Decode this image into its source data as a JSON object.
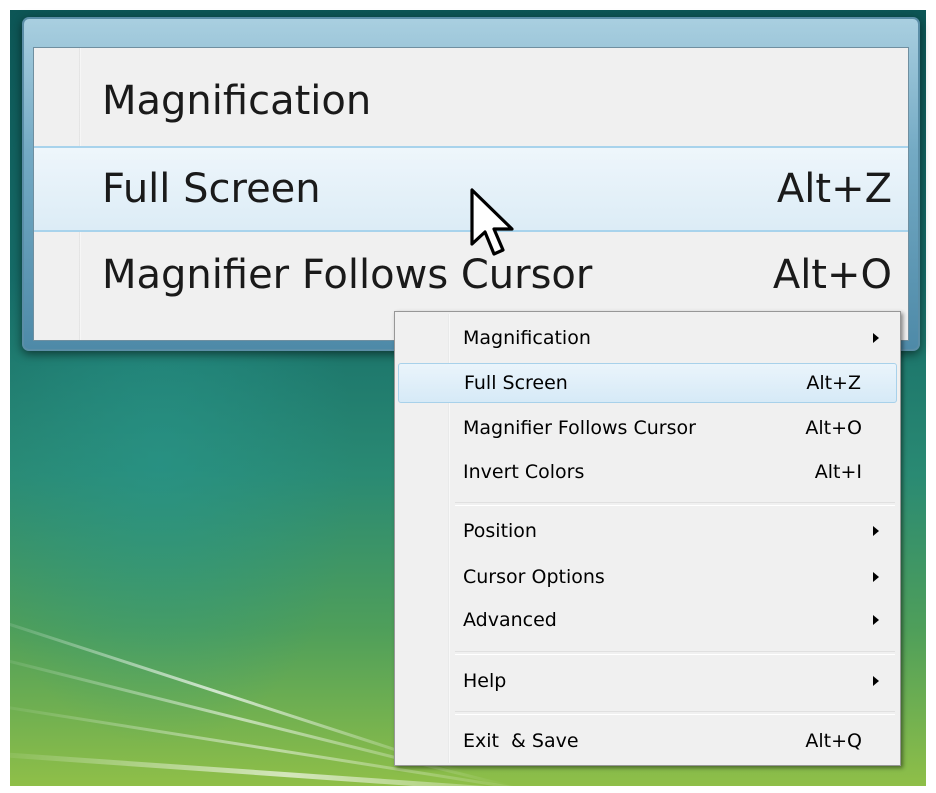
{
  "magnifier_view": {
    "items": [
      {
        "label": "Magnification",
        "shortcut": ""
      },
      {
        "label": "Full Screen",
        "shortcut": "Alt+Z"
      },
      {
        "label": "Magnifier Follows Cursor",
        "shortcut": "Alt+O"
      }
    ]
  },
  "context_menu": {
    "items": [
      {
        "label": "Magnification",
        "shortcut": "",
        "submenu": true
      },
      {
        "label": "Full Screen",
        "shortcut": "Alt+Z",
        "submenu": false,
        "highlighted": true
      },
      {
        "label": "Magnifier Follows Cursor",
        "shortcut": "Alt+O",
        "submenu": false
      },
      {
        "label": "Invert Colors",
        "shortcut": "Alt+I",
        "submenu": false
      },
      {
        "label": "Position",
        "shortcut": "",
        "submenu": true
      },
      {
        "label": "Cursor Options",
        "shortcut": "",
        "submenu": true
      },
      {
        "label": "Advanced",
        "shortcut": "",
        "submenu": true
      },
      {
        "label": "Help",
        "shortcut": "",
        "submenu": true
      },
      {
        "label": "Exit  & Save",
        "shortcut": "Alt+Q",
        "submenu": false
      }
    ]
  },
  "icons": {
    "cursor": "arrow-cursor-icon",
    "submenu": "submenu-arrow-icon"
  },
  "colors": {
    "highlight_border": "#a8d1ea",
    "menu_background": "#f0f0f0",
    "window_frame": "#74aac4"
  }
}
